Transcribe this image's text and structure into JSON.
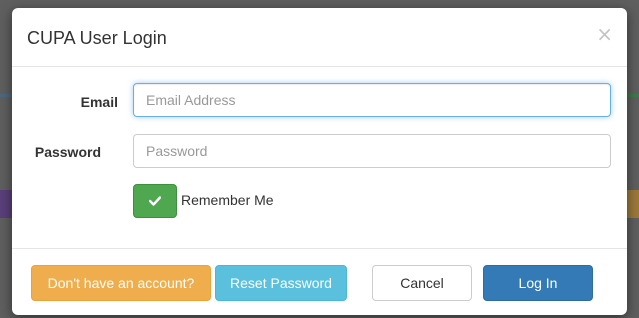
{
  "modal": {
    "title": "CUPA User Login",
    "close_glyph": "×"
  },
  "form": {
    "email_label": "Email",
    "email_placeholder": "Email Address",
    "email_value": "",
    "password_label": "Password",
    "password_placeholder": "Password",
    "password_value": "",
    "remember_label": "Remember Me",
    "remember_checked": true
  },
  "footer": {
    "signup_label": "Don't have an account?",
    "reset_label": "Reset Password",
    "cancel_label": "Cancel",
    "login_label": "Log In"
  },
  "colors": {
    "warning": "#f0ad4e",
    "info": "#5bc0de",
    "primary": "#337ab7",
    "success": "#4fa84f"
  },
  "icons": {
    "close": "close-icon",
    "check": "check-icon"
  }
}
